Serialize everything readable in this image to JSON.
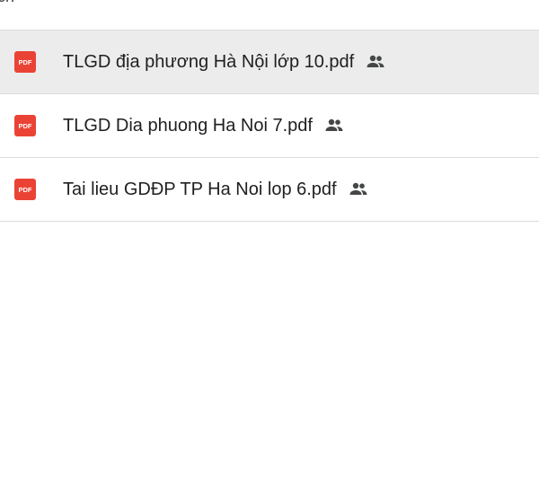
{
  "header": {
    "clipped_text": "rch"
  },
  "files": [
    {
      "name": "TLGD địa phương Hà Nội lớp 10.pdf",
      "type_icon": "pdf-icon",
      "status_icon": "shared-people-icon",
      "selected": true
    },
    {
      "name": "TLGD Dia phuong Ha Noi 7.pdf",
      "type_icon": "pdf-icon",
      "status_icon": "shared-people-icon",
      "selected": false
    },
    {
      "name": "Tai lieu GDĐP TP Ha Noi lop 6.pdf",
      "type_icon": "pdf-icon",
      "status_icon": "shared-people-icon",
      "selected": false
    }
  ],
  "pdf_icon_text": "PDF",
  "colors": {
    "pdf_red": "#ea4335",
    "selected_row": "#ececec",
    "divider": "#dadce0",
    "icon_gray": "#444746"
  }
}
